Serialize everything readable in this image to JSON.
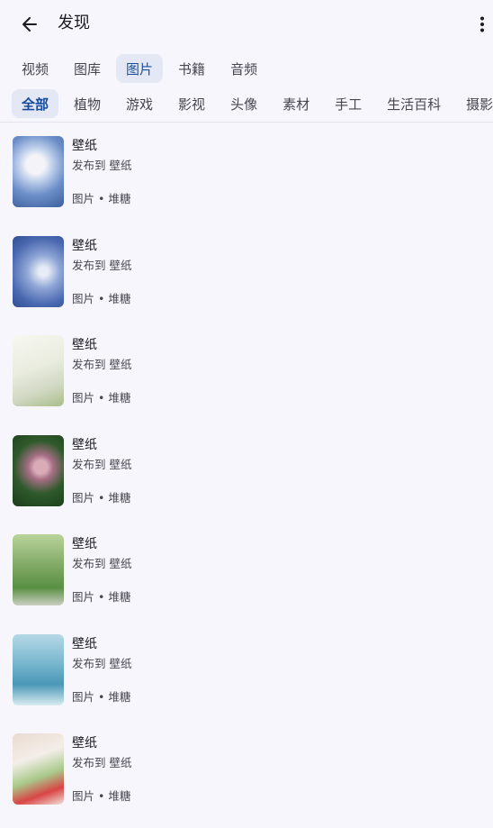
{
  "header": {
    "title": "发现"
  },
  "primary_tabs": [
    {
      "label": "视频"
    },
    {
      "label": "图库"
    },
    {
      "label": "图片",
      "selected": true
    },
    {
      "label": "书籍"
    },
    {
      "label": "音频"
    }
  ],
  "secondary_tabs": [
    {
      "label": "全部",
      "selected": true
    },
    {
      "label": "植物"
    },
    {
      "label": "游戏"
    },
    {
      "label": "影视"
    },
    {
      "label": "头像"
    },
    {
      "label": "素材"
    },
    {
      "label": "手工"
    },
    {
      "label": "生活百科"
    },
    {
      "label": "摄影"
    }
  ],
  "feed": [
    {
      "title": "壁纸",
      "subtitle": "发布到 壁纸",
      "meta": "图片 • 堆糖"
    },
    {
      "title": "壁纸",
      "subtitle": "发布到 壁纸",
      "meta": "图片 • 堆糖"
    },
    {
      "title": "壁纸",
      "subtitle": "发布到 壁纸",
      "meta": "图片 • 堆糖"
    },
    {
      "title": "壁纸",
      "subtitle": "发布到 壁纸",
      "meta": "图片 • 堆糖"
    },
    {
      "title": "壁纸",
      "subtitle": "发布到 壁纸",
      "meta": "图片 • 堆糖"
    },
    {
      "title": "壁纸",
      "subtitle": "发布到 壁纸",
      "meta": "图片 • 堆糖"
    },
    {
      "title": "壁纸",
      "subtitle": "发布到 壁纸",
      "meta": "图片 • 堆糖"
    }
  ],
  "colors": {
    "background": "#f8f6fd",
    "selected_tab_bg": "#e4e8f5",
    "selected_tab_text": "#154a9c"
  },
  "icons": {
    "back": "arrow-left-icon",
    "more": "more-vertical-icon"
  }
}
